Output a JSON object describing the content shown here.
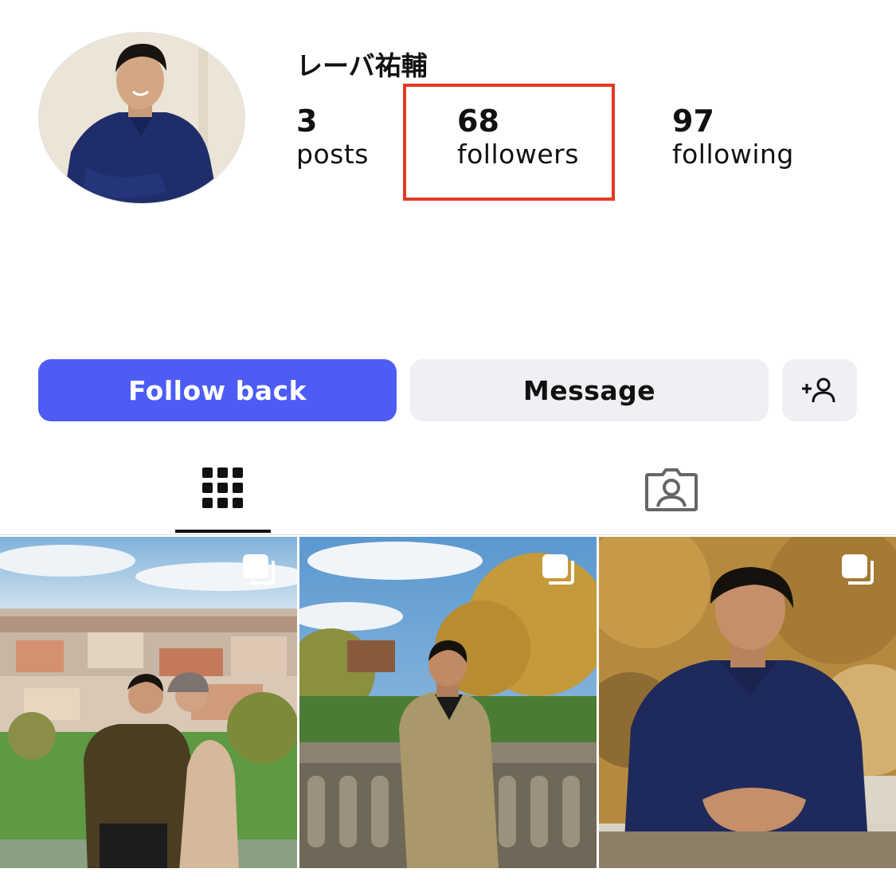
{
  "profile": {
    "username": "レーバ祐輔",
    "stats": [
      {
        "value": "3",
        "label": "posts"
      },
      {
        "value": "68",
        "label": "followers"
      },
      {
        "value": "97",
        "label": "following"
      }
    ]
  },
  "actions": {
    "follow_back": "Follow back",
    "message": "Message",
    "add_person_icon": "add-person-icon"
  },
  "tabs": [
    {
      "icon": "grid-icon",
      "selected": true
    },
    {
      "icon": "tagged-person-icon",
      "selected": false
    }
  ],
  "colors": {
    "follow_button": "#4d5cf5",
    "highlight_box": "#e33b1f",
    "secondary_button": "#eef0f3"
  },
  "posts": [
    {
      "scene": "couple in front of Prague cityscape",
      "icon": "multiple-photos-icon"
    },
    {
      "scene": "man in tan suit leaning on stone balustrade",
      "icon": "multiple-photos-icon"
    },
    {
      "scene": "man in navy shirt sitting among autumn leaves",
      "icon": "multiple-photos-icon"
    }
  ]
}
